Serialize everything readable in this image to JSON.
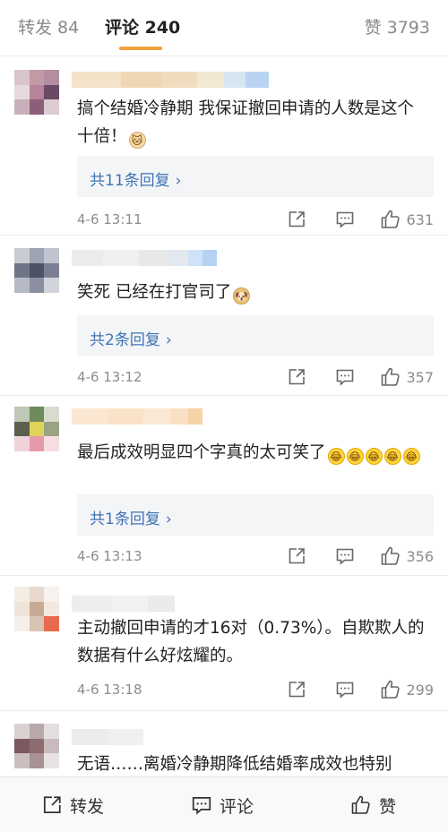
{
  "tabs": {
    "repost": "转发 84",
    "comments": "评论 240",
    "likes": "赞 3793"
  },
  "comments": [
    {
      "text": "搞个结婚冷静期 我保证撤回申请的人数是这个十倍！",
      "emoji": "cat-emoji",
      "replies": "共11条回复",
      "time": "4-6 13:11",
      "likes": "631"
    },
    {
      "text": "笑死 已经在打官司了",
      "emoji": "doge-emoji",
      "replies": "共2条回复",
      "time": "4-6 13:12",
      "likes": "357"
    },
    {
      "text": "最后成效明显四个字真的太可笑了",
      "emoji": "laugh-cry-emoji",
      "replies": "共1条回复",
      "time": "4-6 13:13",
      "likes": "356"
    },
    {
      "text": "主动撤回申请的才16对（0.73%）。自欺欺人的数据有什么好炫耀的。",
      "time": "4-6 13:18",
      "likes": "299"
    },
    {
      "text": "无语……离婚冷静期降低结婚率成效也特别"
    }
  ],
  "reply_arrow": "›",
  "bottom_bar": {
    "repost": "转发",
    "comment": "评论",
    "like": "赞"
  },
  "colors": {
    "accent": "#f2a23c",
    "link": "#3e72b6",
    "muted": "#8c8c8c"
  }
}
